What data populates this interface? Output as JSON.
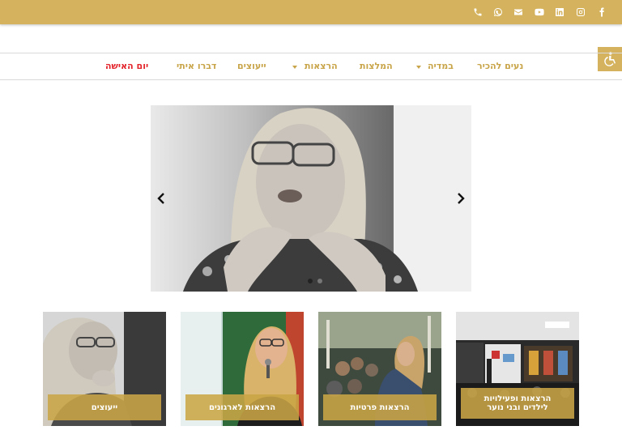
{
  "social": [
    {
      "icon": "facebook-icon"
    },
    {
      "icon": "instagram-icon"
    },
    {
      "icon": "linkedin-icon"
    },
    {
      "icon": "youtube-icon"
    },
    {
      "icon": "email-icon"
    },
    {
      "icon": "whatsapp-icon"
    },
    {
      "icon": "phone-icon"
    }
  ],
  "nav": {
    "items": [
      {
        "label": "נעים להכיר",
        "has_dropdown": false
      },
      {
        "label": "במדיה",
        "has_dropdown": true
      },
      {
        "label": "המלצות",
        "has_dropdown": false
      },
      {
        "label": "הרצאות",
        "has_dropdown": true
      },
      {
        "label": "ייעוצים",
        "has_dropdown": false
      },
      {
        "label": "דברו איתי",
        "has_dropdown": false
      },
      {
        "label": "יום האישה",
        "has_dropdown": false,
        "color": "#e3242b"
      }
    ]
  },
  "accessibility": {
    "icon": "accessibility-icon"
  },
  "slider": {
    "prev_icon": "chevron-left-icon",
    "next_icon": "chevron-right-icon",
    "slide_count": 2,
    "active_slide": 1
  },
  "cards": [
    {
      "label": "ייעוצים"
    },
    {
      "label": "הרצאות לארגונים"
    },
    {
      "label": "הרצאות פרטיות"
    },
    {
      "label_line1": "הרצאות ופעילויות",
      "label_line2": "לילדים ובני נוער"
    }
  ],
  "colors": {
    "brand_gold": "#d5b35e",
    "nav_gold": "#c9a54a",
    "highlight_red": "#e3242b"
  }
}
